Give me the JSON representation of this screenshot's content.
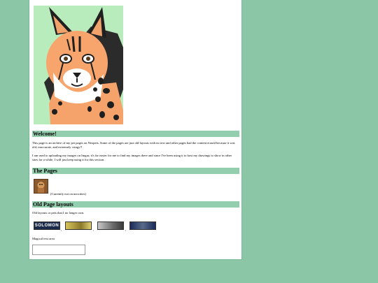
{
  "sections": {
    "welcome": {
      "title": "Welcome!",
      "p1": "This page is an archive of my pet pages on Neopets. Some of the pages are just old layouts with no text and other pages had the content erased because it was old, inaccurate, and extremely cringy!!",
      "p2": "I am used to uploading my images on Imgur, it's far easier for me to find my images there and since I've been using it to host my drawings to show in other sites for a while, I will just keep using it for this section."
    },
    "pages": {
      "title": "The Pages",
      "pet_note": "(Currently not on neocities)"
    },
    "old_layouts": {
      "title": "Old Page layouts",
      "intro": "Old layouts or pets that I no longer own.",
      "banner1_text": "SOLOMON",
      "textarea_label": "Magical text area"
    }
  },
  "colors": {
    "background": "#8bc6a6",
    "panel": "#ffffff",
    "header_bar": "#93cfae"
  },
  "icons": {
    "hero": "lynx-portrait",
    "pet": "pet-thumbnail"
  }
}
